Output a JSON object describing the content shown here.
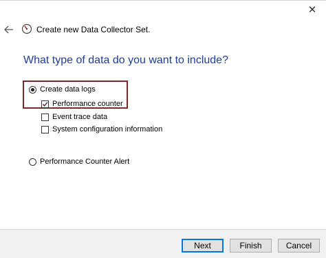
{
  "window": {
    "title": "Create new Data Collector Set.",
    "close_icon": "close-icon",
    "back_icon": "back-arrow-icon",
    "app_icon": "performance-monitor-icon"
  },
  "page": {
    "heading": "What type of data do you want to include?"
  },
  "options": {
    "create_data_logs": {
      "label": "Create data logs",
      "selected": true
    },
    "performance_counter": {
      "label": "Performance counter",
      "checked": true
    },
    "event_trace_data": {
      "label": "Event trace data",
      "checked": false
    },
    "system_configuration": {
      "label": "System configuration information",
      "checked": false
    },
    "performance_counter_alert": {
      "label": "Performance Counter Alert",
      "selected": false
    }
  },
  "buttons": {
    "next": "Next",
    "finish": "Finish",
    "cancel": "Cancel"
  },
  "colors": {
    "heading": "#1f3e9c",
    "highlight_border": "#7b2a2a",
    "default_button_border": "#0078d7"
  }
}
